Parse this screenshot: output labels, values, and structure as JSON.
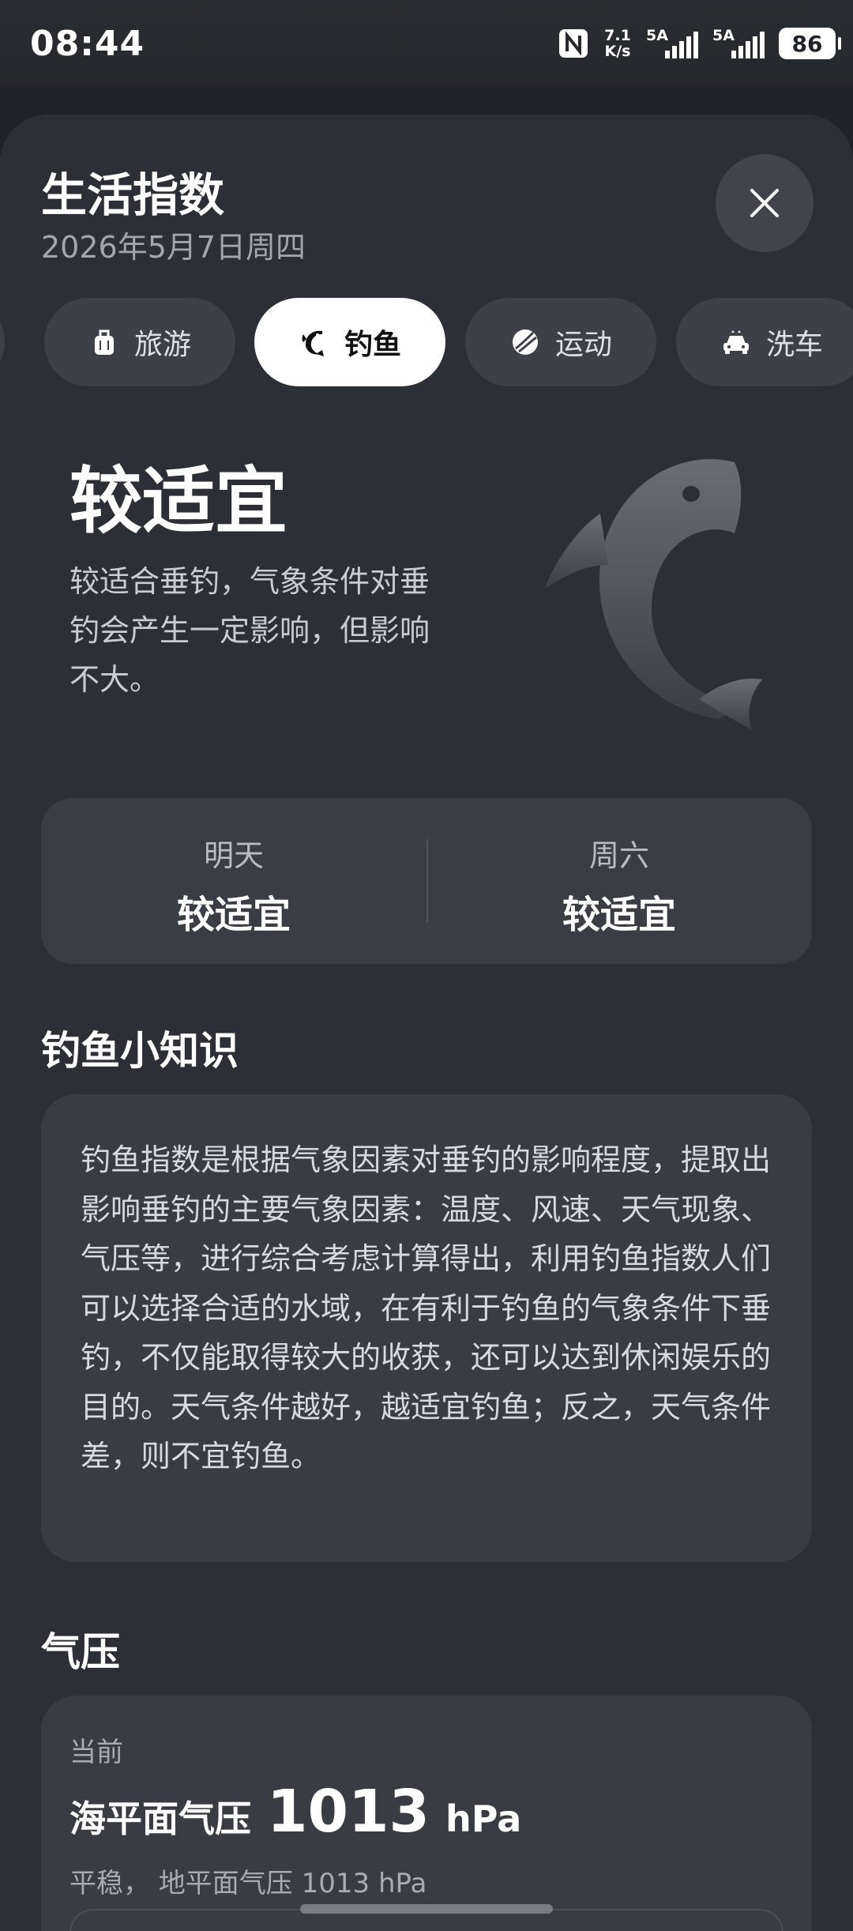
{
  "status_bar": {
    "time": "08:44",
    "net_speed_value": "7.1",
    "net_speed_unit": "K/s",
    "signal1_label": "5A",
    "signal2_label": "5A",
    "battery": "86"
  },
  "header": {
    "title": "生活指数",
    "date": "2026年5月7日周四"
  },
  "tabs": [
    {
      "label": "旅游",
      "icon": "luggage-icon",
      "active": false
    },
    {
      "label": "钓鱼",
      "icon": "fish-icon",
      "active": true
    },
    {
      "label": "运动",
      "icon": "sport-ball-icon",
      "active": false
    },
    {
      "label": "洗车",
      "icon": "car-icon",
      "active": false
    }
  ],
  "hero": {
    "level": "较适宜",
    "description": "较适合垂钓，气象条件对垂钓会产生一定影响，但影响不大。"
  },
  "forecast": [
    {
      "day": "明天",
      "value": "较适宜"
    },
    {
      "day": "周六",
      "value": "较适宜"
    }
  ],
  "knowledge": {
    "title": "钓鱼小知识",
    "text": "钓鱼指数是根据气象因素对垂钓的影响程度，提取出影响垂钓的主要气象因素：温度、风速、天气现象、气压等，进行综合考虑计算得出，利用钓鱼指数人们可以选择合适的水域，在有利于钓鱼的气象条件下垂钓，不仅能取得较大的收获，还可以达到休闲娱乐的目的。天气条件越好，越适宜钓鱼；反之，天气条件差，则不宜钓鱼。"
  },
  "pressure": {
    "title": "气压",
    "current_label": "当前",
    "name": "海平面气压",
    "value": "1013",
    "unit": "hPa",
    "sub": "平稳， 地平面气压 1013 hPa"
  },
  "colors": {
    "background": "#1f2228",
    "sheet": "#2c3036",
    "card": "#393d43",
    "active_tab": "#ffffff"
  }
}
